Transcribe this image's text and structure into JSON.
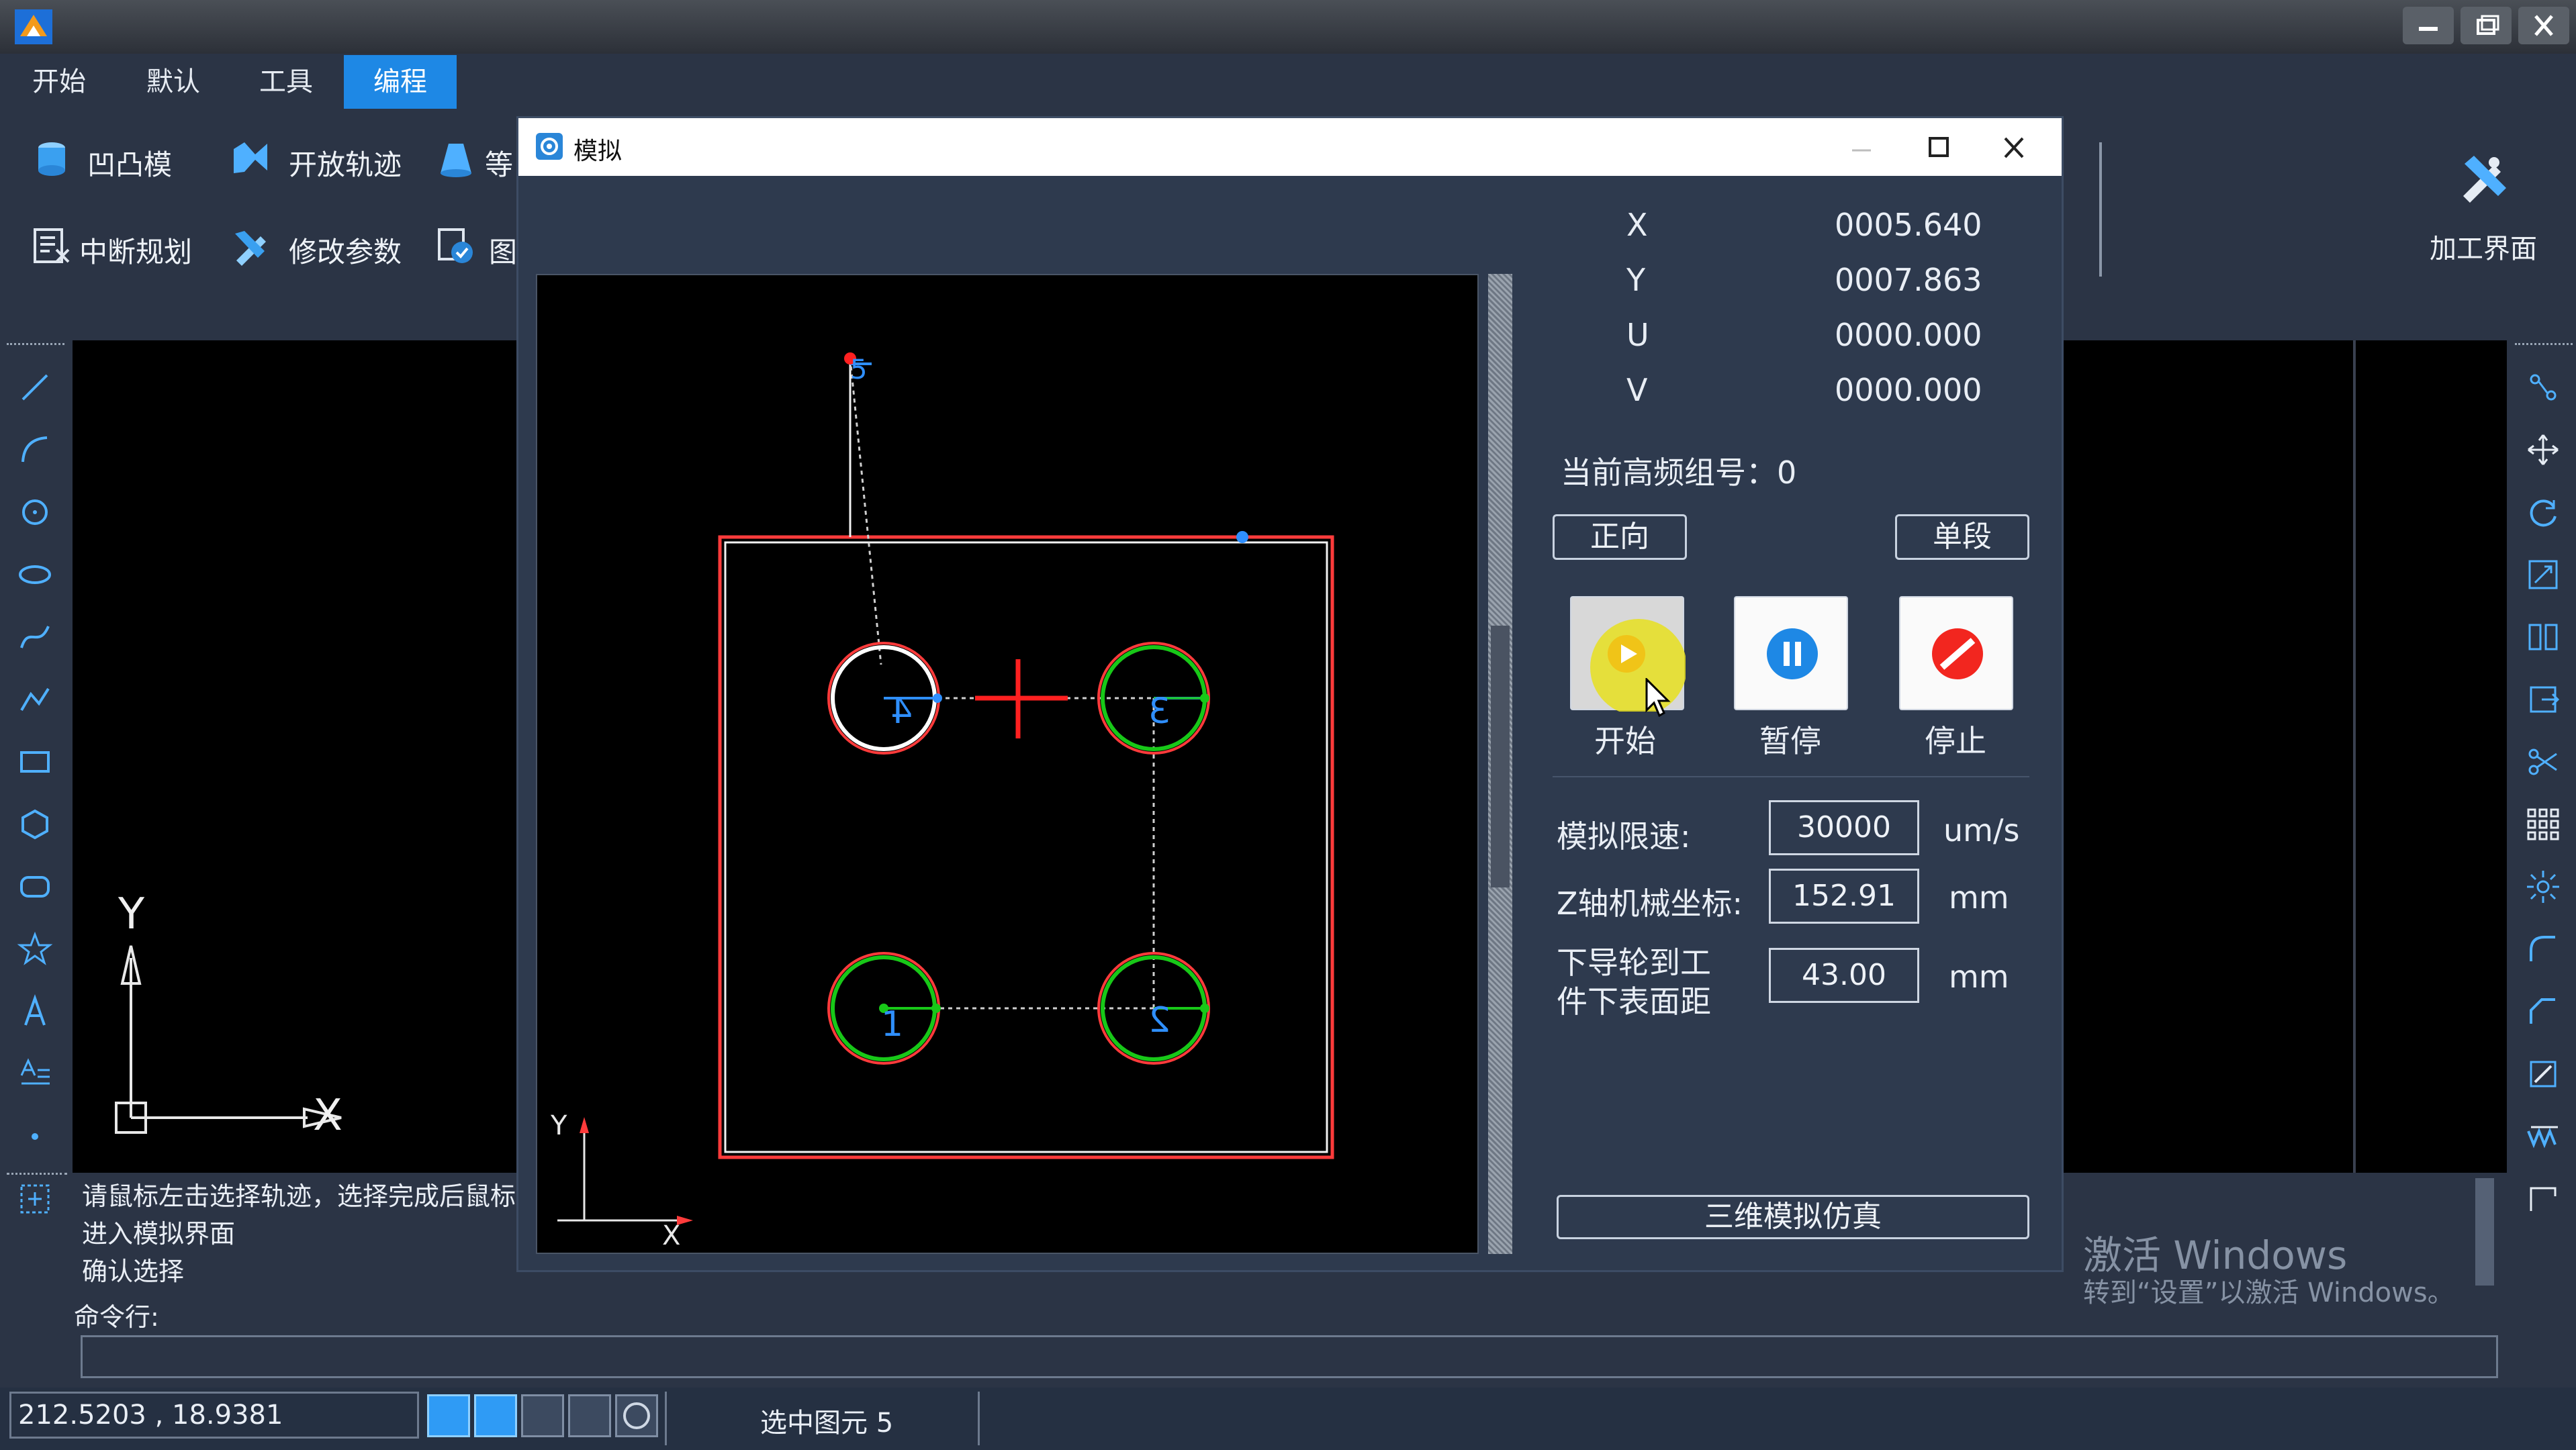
{
  "menu": {
    "items": [
      "开始",
      "默认",
      "工具",
      "编程"
    ],
    "active_index": 3
  },
  "ribbon": {
    "row1": [
      "凹凸模",
      "开放轨迹",
      "等"
    ],
    "row2": [
      "中断规划",
      "修改参数",
      "图"
    ],
    "right_label": "加工界面"
  },
  "left_tools": [
    "line-tool-icon",
    "arc-tool-icon",
    "circle-tool-icon",
    "ellipse-tool-icon",
    "curve-tool-icon",
    "polyline-tool-icon",
    "rectangle-tool-icon",
    "polygon-tool-icon",
    "rounded-rect-tool-icon",
    "star-tool-icon",
    "text-tool-icon",
    "text-format-icon",
    "point-tool-icon",
    "select-box-icon"
  ],
  "right_tools": [
    "node-icon",
    "move-icon",
    "rotate-icon",
    "scale-icon",
    "mirror-icon",
    "offset-icon",
    "scissors-icon",
    "array-icon",
    "explode-icon",
    "fillet-icon",
    "chamfer-icon",
    "trim-icon",
    "wave-icon",
    "corner-icon"
  ],
  "canvas": {
    "axis_y": "Y",
    "axis_x": "X"
  },
  "prompt": {
    "line1": "请鼠标左击选择轨迹，选择完成后鼠标",
    "line2": "进入模拟界面",
    "line3": "确认选择",
    "cmd_label": "命令行:"
  },
  "watermark": {
    "line1": "激活 Windows",
    "line2": "转到“设置”以激活 Windows。"
  },
  "status": {
    "coords": "212.5203 , 18.9381",
    "selected": "选中图元 5"
  },
  "dialog": {
    "title": "模拟",
    "coords": [
      {
        "axis": "X",
        "value": "0005.640"
      },
      {
        "axis": "Y",
        "value": "0007.863"
      },
      {
        "axis": "U",
        "value": "0000.000"
      },
      {
        "axis": "V",
        "value": "0000.000"
      }
    ],
    "hf_group": "当前高频组号：0",
    "forward_btn": "正向",
    "single_btn": "单段",
    "start_label": "开始",
    "pause_label": "暂停",
    "stop_label": "停止",
    "speed_label": "模拟限速:",
    "speed_value": "30000",
    "speed_unit": "um/s",
    "z_label": "Z轴机械坐标:",
    "z_value": "152.91",
    "z_unit": "mm",
    "wheel_label_1": "下导轮到工",
    "wheel_label_2": "件下表面距",
    "wheel_value": "43.00",
    "wheel_unit": "mm",
    "sim3d_btn": "三维模拟仿真",
    "preview_axis_y": "Y",
    "preview_axis_x": "X",
    "path_labels": [
      "5",
      "4",
      "3",
      "1",
      "2"
    ],
    "colors": {
      "outline": "#ff3b3b",
      "circle_green": "#18c818",
      "circle_white": "#ffffff",
      "path_blue": "#2f8fff",
      "cursor_red": "#ff2020"
    }
  }
}
